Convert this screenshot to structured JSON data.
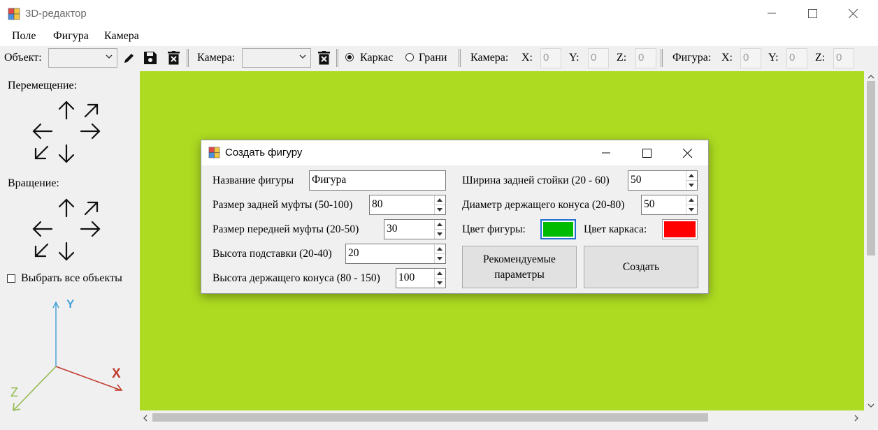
{
  "window": {
    "title": "3D-редактор",
    "controls": {
      "minimize": "minimize-icon",
      "maximize": "maximize-icon",
      "close": "close-icon"
    }
  },
  "menu": {
    "items": [
      "Поле",
      "Фигура",
      "Камера"
    ]
  },
  "toolbar": {
    "object_label": "Объект:",
    "object_value": "",
    "camera_label": "Камера:",
    "camera_value": "",
    "mode_wireframe": "Каркас",
    "mode_faces": "Грани",
    "camera_coords_label": "Камера:",
    "figure_coords_label": "Фигура:",
    "x_label": "X:",
    "y_label": "Y:",
    "z_label": "Z:",
    "camera_x": "0",
    "camera_y": "0",
    "camera_z": "0",
    "figure_x": "0",
    "figure_y": "0",
    "figure_z": "0"
  },
  "sidebar": {
    "move_label": "Перемещение:",
    "rotate_label": "Вращение:",
    "select_all_label": "Выбрать все объекты",
    "axes": {
      "x": "X",
      "y": "Y",
      "z": "Z"
    }
  },
  "dialog": {
    "title": "Создать фигуру",
    "name_label": "Название фигуры",
    "name_value": "Фигура",
    "rear_coupling_label": "Размер задней муфты (50-100)",
    "rear_coupling_value": "80",
    "front_coupling_label": "Размер передней муфты (20-50)",
    "front_coupling_value": "30",
    "stand_height_label": "Высота подставки (20-40)",
    "stand_height_value": "20",
    "cone_height_label": "Высота держащего конуса (80 - 150)",
    "cone_height_value": "100",
    "rear_post_width_label": "Ширина задней стойки (20 - 60)",
    "rear_post_width_value": "50",
    "cone_diameter_label": "Диаметр держащего конуса (20-80)",
    "cone_diameter_value": "50",
    "figure_color_label": "Цвет фигуры:",
    "wireframe_color_label": "Цвет каркаса:",
    "figure_color": "#00bb00",
    "wireframe_color": "#ff0000",
    "recommended_button": "Рекомендуемые параметры",
    "create_button": "Создать"
  },
  "colors": {
    "canvas": "#addb21",
    "axis_x": "#c0392b",
    "axis_y": "#4aa3d8",
    "axis_z": "#8fb84a"
  }
}
